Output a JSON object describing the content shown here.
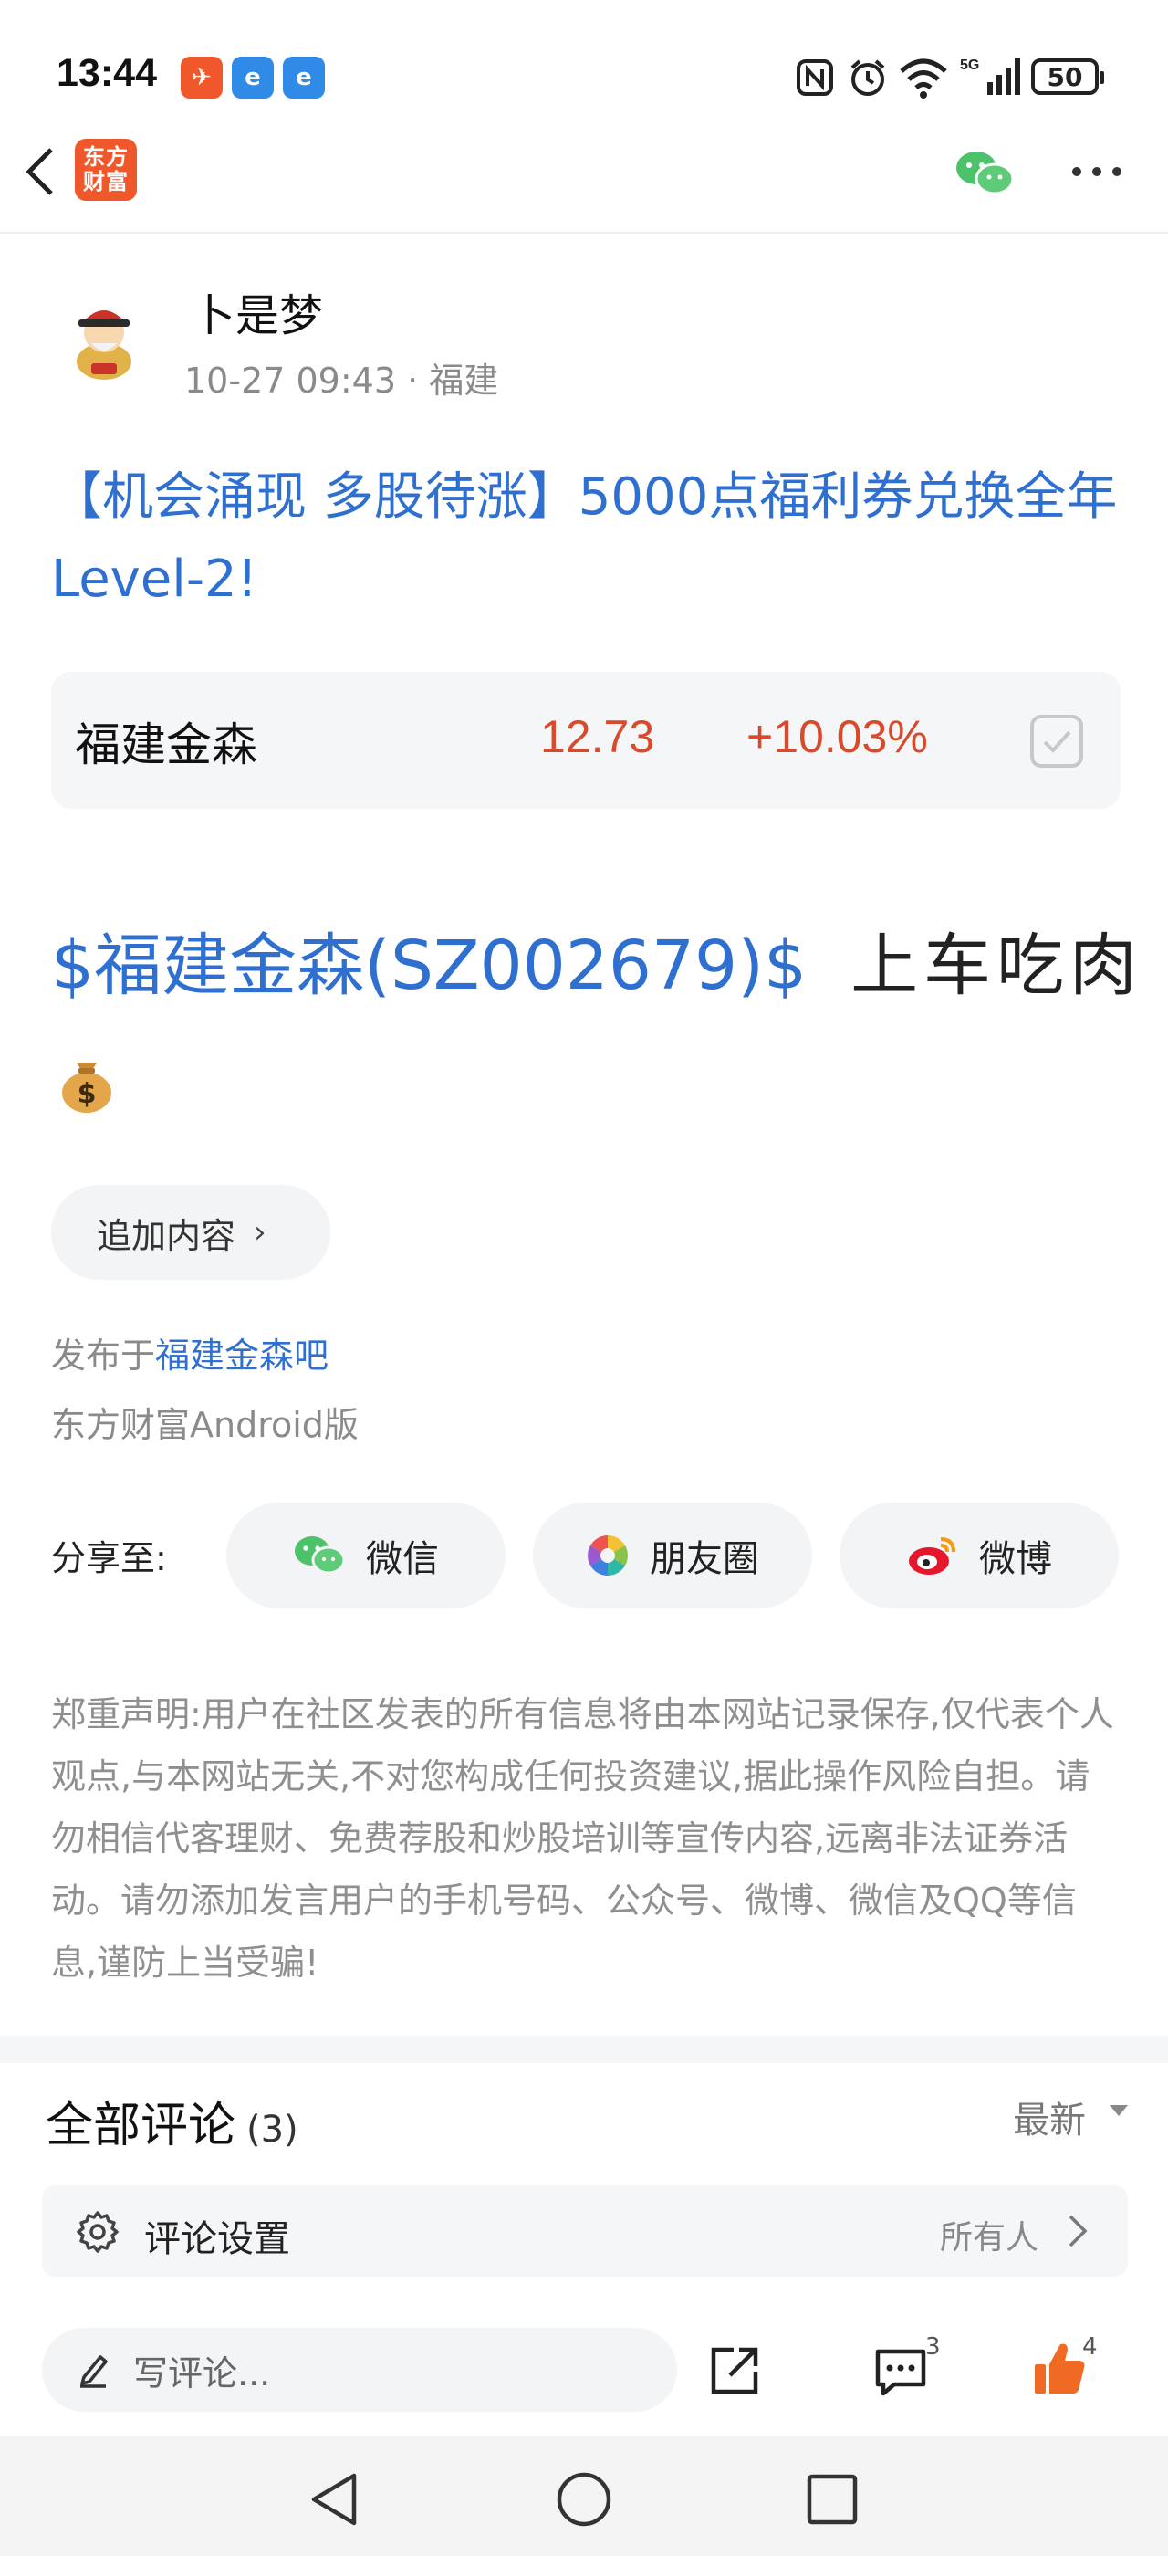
{
  "status_bar": {
    "time": "13:44",
    "battery": "50",
    "network": "5G"
  },
  "header": {
    "logo_line1": "东方",
    "logo_line2": "财富",
    "logo_color": "#f0582c"
  },
  "post": {
    "author": "卜是梦",
    "meta": "10-27 09:43 · 福建",
    "title": "【机会涌现 多股待涨】5000点福利券兑换全年Level-2!",
    "stock_card": {
      "name": "福建金森",
      "price": "12.73",
      "change": "+10.03%",
      "up_color": "#d84a2b"
    },
    "content_stock": "$福建金森(SZ002679)$",
    "content_text": "上车吃肉",
    "add_content": "追加内容",
    "publish_prefix": "发布于",
    "publish_bar": "福建金森吧",
    "client": "东方财富Android版",
    "share_label": "分享至:",
    "share": [
      {
        "label": "微信",
        "icon": "wechat-icon"
      },
      {
        "label": "朋友圈",
        "icon": "moments-icon"
      },
      {
        "label": "微博",
        "icon": "weibo-icon"
      }
    ],
    "disclaimer": "郑重声明:用户在社区发表的所有信息将由本网站记录保存,仅代表个人观点,与本网站无关,不对您构成任何投资建议,据此操作风险自担。请勿相信代客理财、免费荐股和炒股培训等宣传内容,远离非法证券活动。请勿添加发言用户的手机号码、公众号、微博、微信及QQ等信息,谨防上当受骗!"
  },
  "comments": {
    "title": "全部评论",
    "count": "(3)",
    "sort": "最新",
    "settings_label": "评论设置",
    "settings_value": "所有人"
  },
  "bottom_bar": {
    "compose_placeholder": "写评论...",
    "comment_badge": "3",
    "like_badge": "4"
  },
  "colors": {
    "link": "#2e6fd0",
    "like": "#f06a24"
  }
}
